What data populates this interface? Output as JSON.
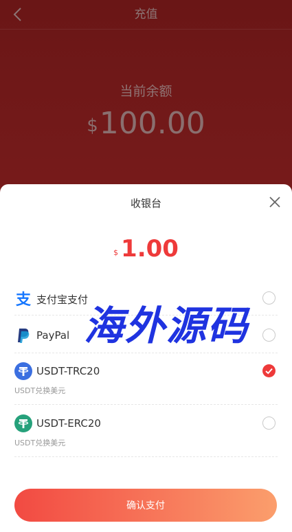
{
  "header": {
    "title": "充值",
    "back_icon": "chevron-left-icon"
  },
  "balance": {
    "label": "当前余额",
    "currency_symbol": "$",
    "amount": "100.00"
  },
  "cashier": {
    "title": "收银台",
    "close_icon": "close-icon",
    "currency_symbol": "$",
    "amount": "1.00",
    "methods": [
      {
        "name": "支付宝支付",
        "icon": "alipay-icon",
        "subtitle": "",
        "selected": false
      },
      {
        "name": "PayPal",
        "icon": "paypal-icon",
        "subtitle": "",
        "selected": false
      },
      {
        "name": "USDT-TRC20",
        "icon": "tether-trc20-icon",
        "subtitle": "USDT兑换美元",
        "selected": true
      },
      {
        "name": "USDT-ERC20",
        "icon": "tether-erc20-icon",
        "subtitle": "USDT兑换美元",
        "selected": false
      }
    ],
    "confirm_label": "确认支付"
  },
  "watermark": "海外源码",
  "colors": {
    "accent": "#ee3a3a",
    "header_bg": "#6a1616",
    "watermark": "#1f33e0"
  }
}
